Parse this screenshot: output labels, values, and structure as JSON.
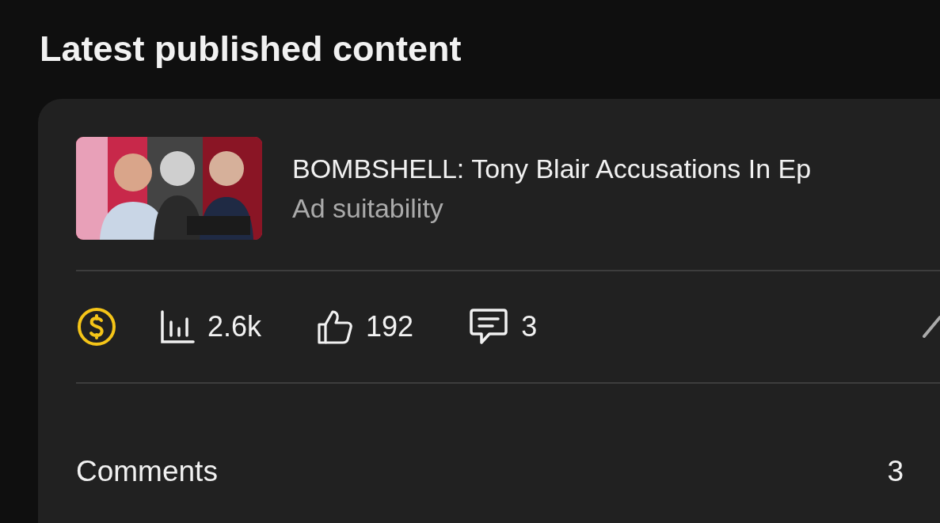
{
  "section_title": "Latest published content",
  "video": {
    "title": "BOMBSHELL: Tony Blair Accusations In Ep",
    "subtitle": "Ad suitability"
  },
  "stats": [
    {
      "kind": "views",
      "value": "2.6k"
    },
    {
      "kind": "likes",
      "value": "192"
    },
    {
      "kind": "comments",
      "value": "3"
    }
  ],
  "comments": {
    "label": "Comments",
    "count": "3"
  }
}
